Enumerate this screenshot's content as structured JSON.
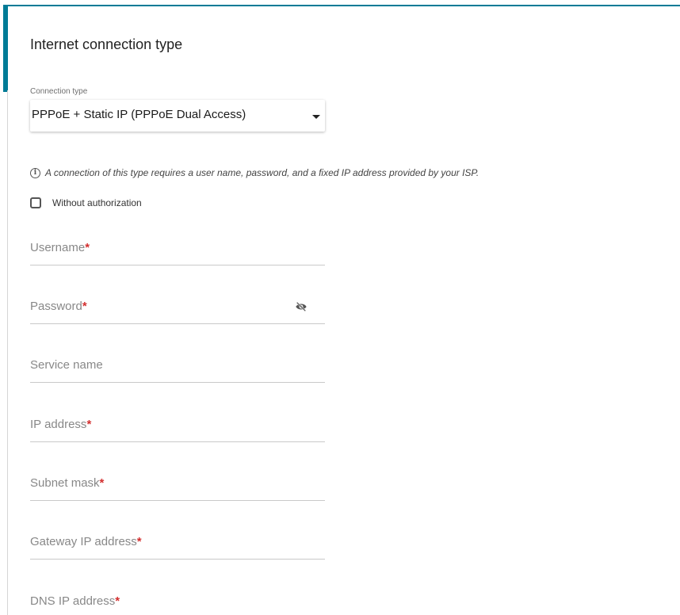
{
  "section": {
    "title": "Internet connection type"
  },
  "connection_type": {
    "label": "Connection type",
    "selected": "PPPoE + Static IP (PPPoE Dual Access)"
  },
  "info": {
    "icon": "info-icon",
    "text": "A connection of this type requires a user name, password, and a fixed IP address provided by your ISP."
  },
  "without_authorization": {
    "label": "Without authorization",
    "checked": false
  },
  "fields": {
    "username": {
      "label": "Username",
      "required": "*"
    },
    "password": {
      "label": "Password",
      "required": "*",
      "icon": "eye-slash-icon"
    },
    "service_name": {
      "label": "Service name"
    },
    "ip_address": {
      "label": "IP address",
      "required": "*"
    },
    "subnet_mask": {
      "label": "Subnet mask",
      "required": "*"
    },
    "gateway_ip": {
      "label": "Gateway IP address",
      "required": "*"
    },
    "dns_ip": {
      "label": "DNS IP address",
      "required": "*"
    }
  },
  "colors": {
    "accent": "#007b96",
    "required": "#d32f2f"
  }
}
